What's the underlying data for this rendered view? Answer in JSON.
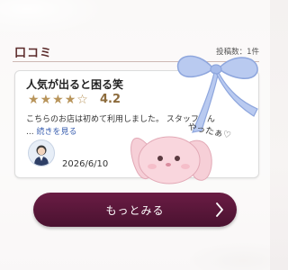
{
  "section": {
    "title": "口コミ",
    "post_count": "投稿数：1件"
  },
  "review": {
    "title": "人気が出ると困る笑",
    "rating": 4.2,
    "rating_text": "4.2",
    "stars_filled": 4,
    "stars_total": 5,
    "text": "こちらのお店は初めて利用しました。 スタッフさん",
    "ellipsis": "...",
    "read_more": "続きを見る",
    "date": "2026/6/10"
  },
  "sticker": {
    "text": "やったぁ♡"
  },
  "button": {
    "label": "もっとみる"
  },
  "colors": {
    "accent": "#5b2a2a",
    "button": "#5a1638",
    "star": "#b8945a",
    "link": "#3a5fb0",
    "ribbon": "#9fb6e6",
    "bunny": "#f3c9d2"
  },
  "icons": {
    "avatar": "user-avatar-icon",
    "chevron": "chevron-right-icon",
    "ribbon": "ribbon-sticker",
    "bunny": "bunny-sticker"
  }
}
